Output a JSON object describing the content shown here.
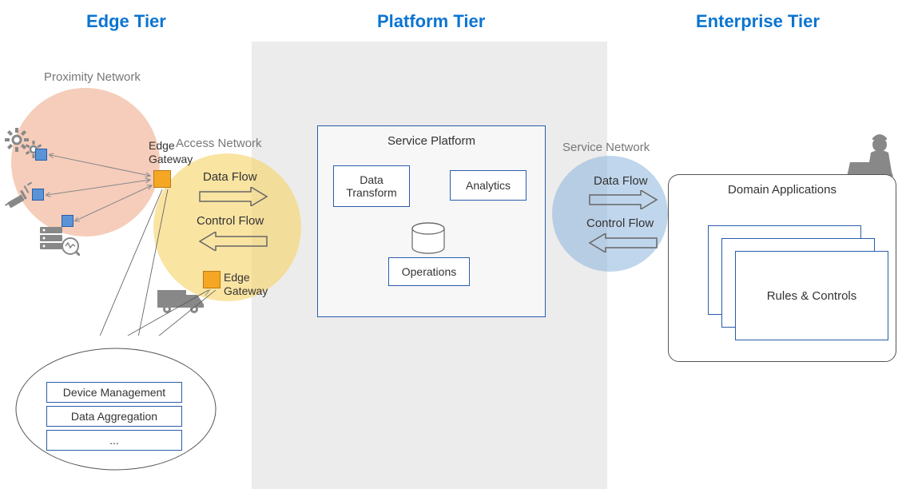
{
  "tiers": {
    "edge": "Edge Tier",
    "platform": "Platform Tier",
    "enterprise": "Enterprise Tier"
  },
  "networks": {
    "proximity": "Proximity Network",
    "access": "Access Network",
    "service": "Service Network"
  },
  "edge": {
    "gateway1": "Edge\nGateway",
    "gateway2": "Edge\nGateway",
    "capabilities": {
      "device_mgmt": "Device Management",
      "data_agg": "Data Aggregation",
      "more": "..."
    }
  },
  "flows": {
    "data": "Data Flow",
    "control": "Control Flow"
  },
  "platform": {
    "title": "Service Platform",
    "data_transform": "Data\nTransform",
    "analytics": "Analytics",
    "operations": "Operations"
  },
  "enterprise": {
    "title": "Domain Applications",
    "rules": "Rules & Controls"
  },
  "icons": {
    "gears": "gears-icon",
    "syringe": "syringe-icon",
    "server": "server-monitor-icon",
    "truck": "truck-icon",
    "worker": "worker-laptop-icon",
    "database": "database-icon"
  }
}
